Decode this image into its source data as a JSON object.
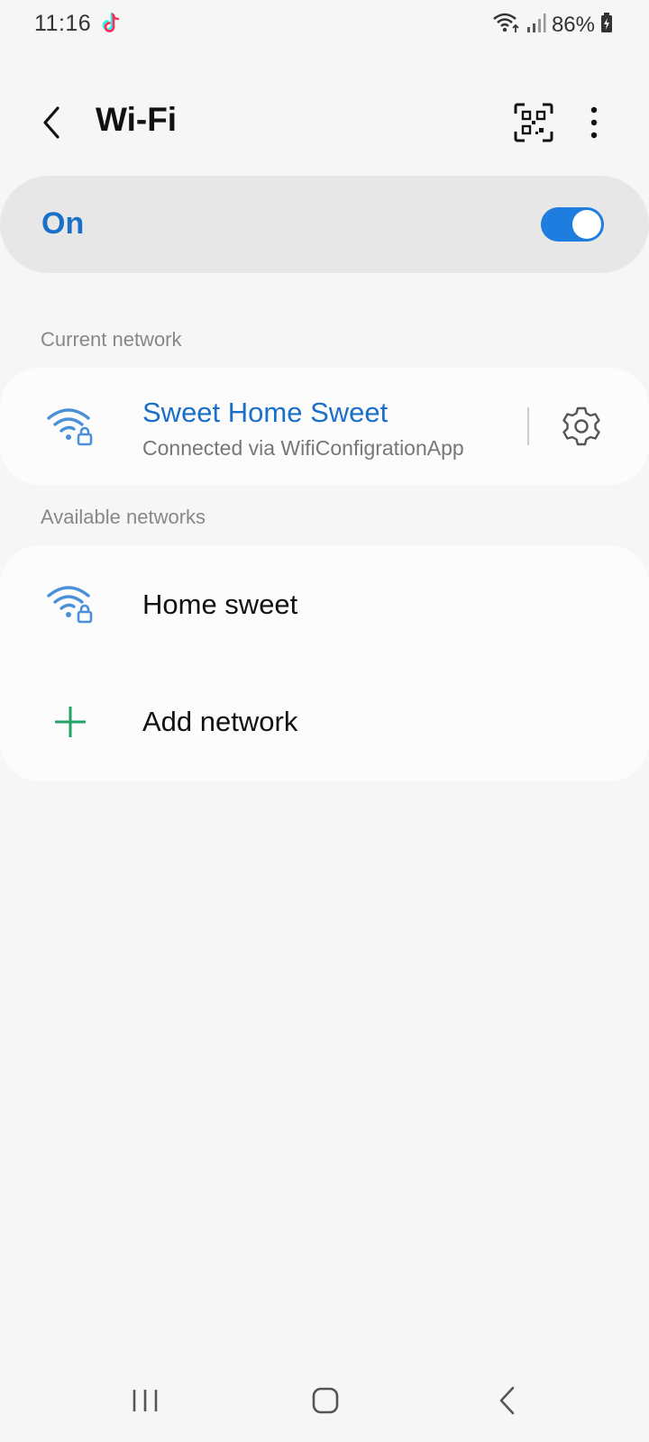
{
  "status_bar": {
    "time": "11:16",
    "battery": "86%",
    "icons": [
      "tiktok-icon",
      "wifi-signal-icon",
      "cellular-signal-icon",
      "battery-charging-icon"
    ]
  },
  "header": {
    "title": "Wi-Fi",
    "back_icon": "chevron-left-icon",
    "qr_icon": "qr-scan-icon",
    "more_icon": "more-vertical-icon"
  },
  "wifi_toggle": {
    "label": "On",
    "state": true
  },
  "current_network": {
    "section_title": "Current network",
    "name": "Sweet Home Sweet",
    "status": "Connected via WifiConfigrationApp",
    "icon": "wifi-lock-icon",
    "settings_icon": "gear-icon"
  },
  "available_networks": {
    "section_title": "Available networks",
    "items": [
      {
        "name": "Home sweet",
        "icon": "wifi-lock-icon"
      }
    ],
    "add_network_label": "Add network",
    "add_icon": "plus-icon"
  },
  "nav_bar": {
    "icons": [
      "recents-icon",
      "home-icon",
      "back-icon"
    ]
  },
  "colors": {
    "accent": "#1a6fc9",
    "toggle_on": "#1f7de0",
    "wifi_icon": "#4a90d9",
    "add_icon": "#21a366",
    "background": "#f6f6f6",
    "card": "#fcfcfc"
  }
}
